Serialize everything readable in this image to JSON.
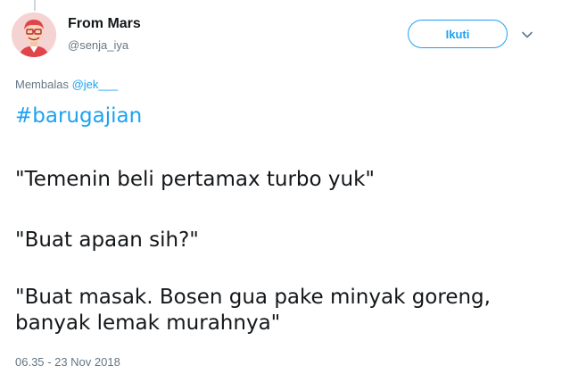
{
  "tweet": {
    "author": {
      "name": "From Mars",
      "handle": "@senja_iya"
    },
    "follow_label": "Ikuti",
    "reply_prefix": "Membalas",
    "reply_to": "@jek___",
    "hashtag": "#barugajian",
    "lines": [
      "\"Temenin beli pertamax turbo yuk\"",
      "\"Buat apaan sih?\"",
      "\"Buat masak. Bosen gua pake minyak goreng,",
      "banyak lemak murahnya\""
    ],
    "timestamp": "06.35 - 23 Nov 2018"
  },
  "colors": {
    "accent": "#1da1f2",
    "secondary_text": "#657786",
    "primary_text": "#14171a"
  },
  "icons": {
    "avatar": "cartoon-avatar",
    "menu": "chevron-down-icon"
  }
}
